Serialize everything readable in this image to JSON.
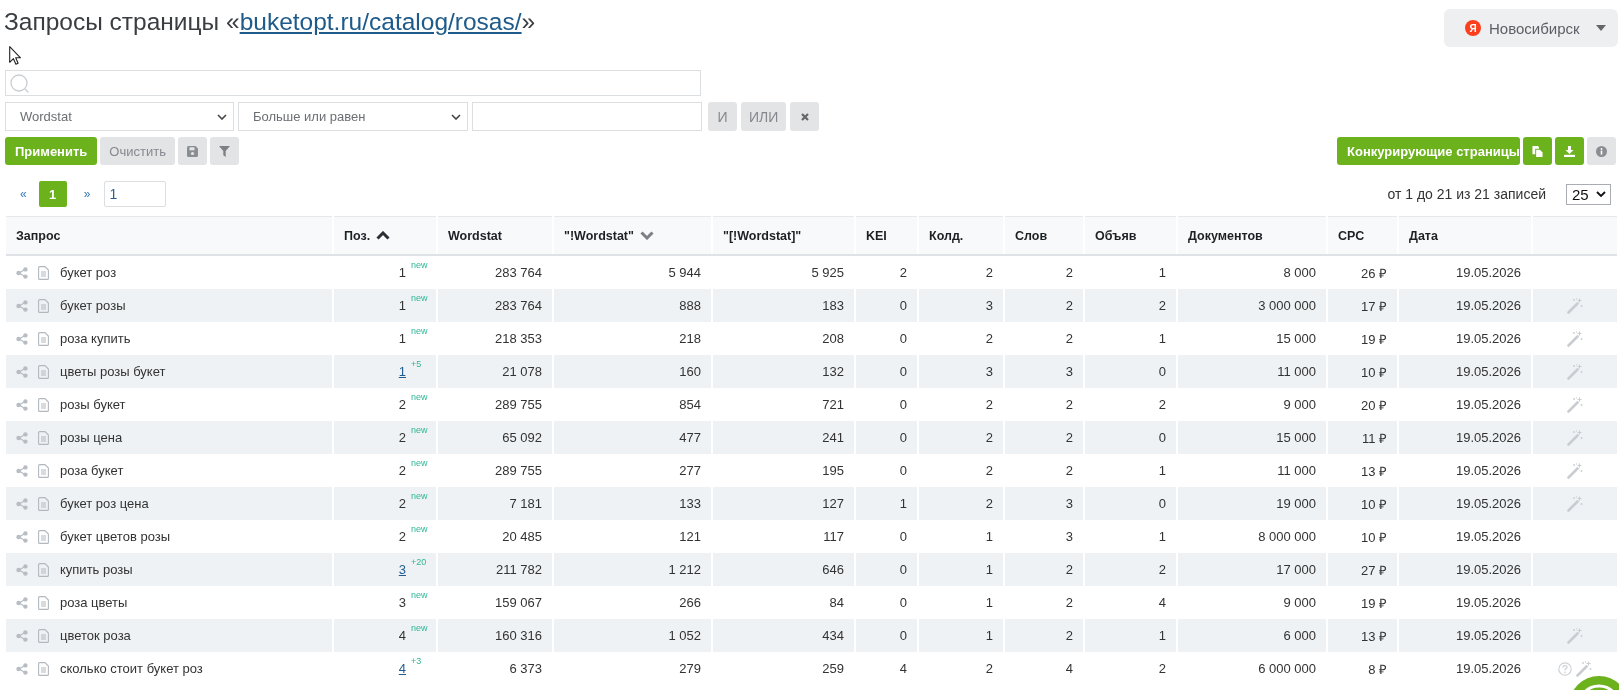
{
  "title": {
    "text": "Запросы страницы «",
    "link": "buketopt.ru/catalog/rosas/",
    "suffix": "»"
  },
  "region": {
    "logo": "Я",
    "name": "Новосибирск"
  },
  "filter": {
    "field": "Wordstat",
    "condition": "Больше или равен",
    "logic_buttons": [
      "И",
      "ИЛИ"
    ]
  },
  "actions": {
    "apply": "Применить",
    "clear": "Очистить",
    "competitors": "Конкурирующие страницы"
  },
  "pagination": {
    "prev": "«",
    "pages": [
      {
        "label": "1",
        "selected": true
      }
    ],
    "next": "»",
    "page_input": "1",
    "summary": "от 1 до 21 из 21 записей",
    "page_size": "25"
  },
  "table": {
    "columns": [
      {
        "label": "Запрос",
        "sorted_ascending": false,
        "sorted_descending": false
      },
      {
        "label": "Поз.",
        "sorted_ascending": true,
        "sorted_descending": false
      },
      {
        "label": "Wordstat",
        "sorted_ascending": false,
        "sorted_descending": false
      },
      {
        "label": "\"!Wordstat\"",
        "sorted_ascending": false,
        "sorted_descending": true
      },
      {
        "label": "\"[!Wordstat]\"",
        "sorted_ascending": false,
        "sorted_descending": false
      },
      {
        "label": "KEI",
        "sorted_ascending": false,
        "sorted_descending": false
      },
      {
        "label": "Колд.",
        "sorted_ascending": false,
        "sorted_descending": false
      },
      {
        "label": "Слов",
        "sorted_ascending": false,
        "sorted_descending": false
      },
      {
        "label": "Объяв",
        "sorted_ascending": false,
        "sorted_descending": false
      },
      {
        "label": "Документов",
        "sorted_ascending": false,
        "sorted_descending": false
      },
      {
        "label": "CPC",
        "sorted_ascending": false,
        "sorted_descending": false
      },
      {
        "label": "Дата",
        "sorted_ascending": false,
        "sorted_descending": false
      }
    ],
    "rows": [
      {
        "cells": [
          "букет роз",
          "1",
          "283 764",
          "5 944",
          "5 925",
          "2",
          "2",
          "2",
          "1",
          "8 000",
          "26 ₽",
          "19.05.2026"
        ],
        "linked": false,
        "badge": "new",
        "help": false,
        "wand": false
      },
      {
        "cells": [
          "букет розы",
          "1",
          "283 764",
          "888",
          "183",
          "0",
          "3",
          "2",
          "2",
          "3 000 000",
          "17 ₽",
          "19.05.2026"
        ],
        "linked": false,
        "badge": "new",
        "help": false,
        "wand": true
      },
      {
        "cells": [
          "роза купить",
          "1",
          "218 353",
          "218",
          "208",
          "0",
          "2",
          "2",
          "1",
          "15 000",
          "19 ₽",
          "19.05.2026"
        ],
        "linked": false,
        "badge": "new",
        "help": false,
        "wand": true
      },
      {
        "cells": [
          "цветы розы букет",
          "1",
          "21 078",
          "160",
          "132",
          "0",
          "3",
          "3",
          "0",
          "11 000",
          "10 ₽",
          "19.05.2026"
        ],
        "linked": true,
        "badge": "+5",
        "help": false,
        "wand": true
      },
      {
        "cells": [
          "розы букет",
          "2",
          "289 755",
          "854",
          "721",
          "0",
          "2",
          "2",
          "2",
          "9 000",
          "20 ₽",
          "19.05.2026"
        ],
        "linked": false,
        "badge": "new",
        "help": false,
        "wand": true
      },
      {
        "cells": [
          "розы цена",
          "2",
          "65 092",
          "477",
          "241",
          "0",
          "2",
          "2",
          "0",
          "15 000",
          "11 ₽",
          "19.05.2026"
        ],
        "linked": false,
        "badge": "new",
        "help": false,
        "wand": true
      },
      {
        "cells": [
          "роза букет",
          "2",
          "289 755",
          "277",
          "195",
          "0",
          "2",
          "2",
          "1",
          "11 000",
          "13 ₽",
          "19.05.2026"
        ],
        "linked": false,
        "badge": "new",
        "help": false,
        "wand": true
      },
      {
        "cells": [
          "букет роз цена",
          "2",
          "7 181",
          "133",
          "127",
          "1",
          "2",
          "3",
          "0",
          "19 000",
          "10 ₽",
          "19.05.2026"
        ],
        "linked": false,
        "badge": "new",
        "help": false,
        "wand": true
      },
      {
        "cells": [
          "букет цветов розы",
          "2",
          "20 485",
          "121",
          "117",
          "0",
          "1",
          "3",
          "1",
          "8 000 000",
          "10 ₽",
          "19.05.2026"
        ],
        "linked": false,
        "badge": "new",
        "help": false,
        "wand": false
      },
      {
        "cells": [
          "купить розы",
          "3",
          "211 782",
          "1 212",
          "646",
          "0",
          "1",
          "2",
          "2",
          "17 000",
          "27 ₽",
          "19.05.2026"
        ],
        "linked": true,
        "badge": "+20",
        "help": false,
        "wand": false
      },
      {
        "cells": [
          "роза цветы",
          "3",
          "159 067",
          "266",
          "84",
          "0",
          "1",
          "2",
          "4",
          "9 000",
          "19 ₽",
          "19.05.2026"
        ],
        "linked": false,
        "badge": "new",
        "help": false,
        "wand": false
      },
      {
        "cells": [
          "цветок роза",
          "4",
          "160 316",
          "1 052",
          "434",
          "0",
          "1",
          "2",
          "1",
          "6 000",
          "13 ₽",
          "19.05.2026"
        ],
        "linked": false,
        "badge": "new",
        "help": false,
        "wand": true
      },
      {
        "cells": [
          "сколько стоит букет роз",
          "4",
          "6 373",
          "279",
          "259",
          "4",
          "2",
          "4",
          "2",
          "6 000 000",
          "8 ₽",
          "19.05.2026"
        ],
        "linked": true,
        "badge": "+3",
        "help": true,
        "wand": true
      }
    ]
  }
}
